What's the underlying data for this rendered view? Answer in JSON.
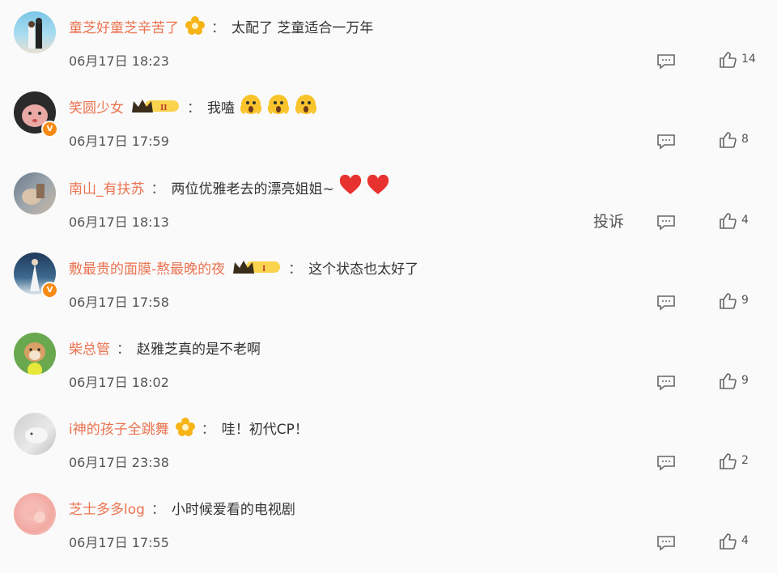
{
  "comments": [
    {
      "username": "童芝好童芝辛苦了",
      "badge": "gold-flower",
      "colon": "：",
      "text": "太配了 芝童适合一万年",
      "emojis": [],
      "time": "06月17日 18:23",
      "likes": "14",
      "verified": false,
      "report": ""
    },
    {
      "username": "笑圆少女",
      "badge": "crown-II",
      "badge_label": "II",
      "colon": "：",
      "text": "我嗑",
      "emojis": [
        "scream-emoji",
        "scream-emoji",
        "scream-emoji"
      ],
      "time": "06月17日 17:59",
      "likes": "8",
      "verified": true,
      "report": ""
    },
    {
      "username": "南山_有扶苏",
      "badge": "",
      "colon": "：",
      "text": "两位优雅老去的漂亮姐姐~",
      "emojis": [
        "heart-emoji",
        "heart-emoji"
      ],
      "time": "06月17日 18:13",
      "likes": "4",
      "verified": false,
      "report": "投诉"
    },
    {
      "username": "敷最贵的面膜-熬最晚的夜",
      "badge": "crown-I",
      "badge_label": "I",
      "colon": "：",
      "text": "这个状态也太好了",
      "emojis": [],
      "time": "06月17日 17:58",
      "likes": "9",
      "verified": true,
      "report": ""
    },
    {
      "username": "柴总管",
      "badge": "",
      "colon": "：",
      "text": "赵雅芝真的是不老啊",
      "emojis": [],
      "time": "06月17日 18:02",
      "likes": "9",
      "verified": false,
      "report": ""
    },
    {
      "username": "i神的孩子全跳舞",
      "badge": "gold-flower",
      "colon": "：",
      "text": "哇！初代CP！",
      "emojis": [],
      "time": "06月17日 23:38",
      "likes": "2",
      "verified": false,
      "report": ""
    },
    {
      "username": "芝士多多log",
      "badge": "",
      "colon": "：",
      "text": "小时候爱看的电视剧",
      "emojis": [],
      "time": "06月17日 17:55",
      "likes": "4",
      "verified": false,
      "report": ""
    }
  ],
  "colors": {
    "username": "#eb7350",
    "verified": "#f78a14",
    "badge_gold": "#f5b400"
  }
}
